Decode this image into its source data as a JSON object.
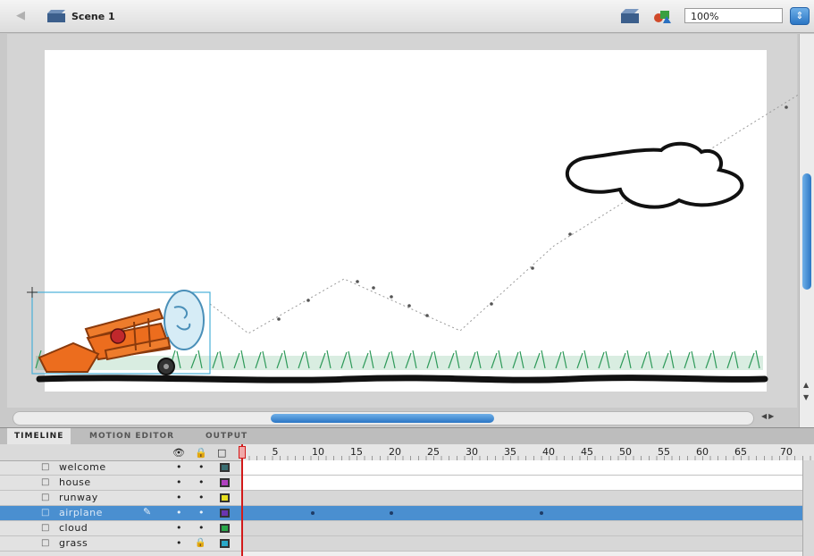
{
  "header": {
    "scene_label": "Scene 1",
    "zoom_value": "100%"
  },
  "tabs": [
    {
      "label": "TIMELINE",
      "active": true
    },
    {
      "label": "MOTION EDITOR",
      "active": false
    },
    {
      "label": "OUTPUT",
      "active": false
    }
  ],
  "timeline": {
    "ruler_numbers": [
      "5",
      "10",
      "15",
      "20",
      "25",
      "30",
      "35",
      "40",
      "45",
      "50",
      "55",
      "60",
      "65",
      "70"
    ],
    "current_frame": 1
  },
  "layers": [
    {
      "name": "welcome",
      "color": "#3a6e72",
      "selected": false
    },
    {
      "name": "house",
      "color": "#b040c0",
      "selected": false
    },
    {
      "name": "runway",
      "color": "#e8e020",
      "selected": false
    },
    {
      "name": "airplane",
      "color": "#6a34b0",
      "selected": true
    },
    {
      "name": "cloud",
      "color": "#2aa84a",
      "selected": false
    },
    {
      "name": "grass",
      "color": "#2aa8c8",
      "selected": false,
      "locked": true
    }
  ],
  "colors": {
    "accent": "#4a8fd0",
    "playhead": "#d21a1a"
  }
}
